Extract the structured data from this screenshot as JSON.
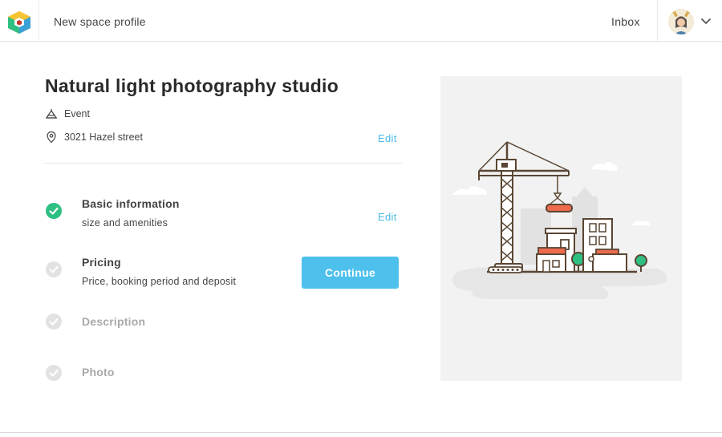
{
  "header": {
    "title": "New space profile",
    "inbox_label": "Inbox"
  },
  "space": {
    "name": "Natural light photography studio",
    "type": "Event",
    "address": "3021 Hazel street",
    "edit_label": "Edit"
  },
  "steps": [
    {
      "title": "Basic information",
      "subtitle": "size and amenities",
      "status": "complete",
      "edit_label": "Edit"
    },
    {
      "title": "Pricing",
      "subtitle": "Price, booking period and deposit",
      "status": "current"
    },
    {
      "title": "Description",
      "status": "pending"
    },
    {
      "title": "Photo",
      "status": "pending"
    }
  ],
  "actions": {
    "continue_label": "Continue"
  },
  "colors": {
    "accent": "#4ec0ec",
    "link": "#4ab9e6",
    "complete": "#2ebf82",
    "pending": "#d8d8d8"
  },
  "icons": {
    "logo": "cube-logo-icon",
    "type": "event-tent-icon",
    "address": "location-pin-icon",
    "user_menu": "chevron-down-icon"
  }
}
